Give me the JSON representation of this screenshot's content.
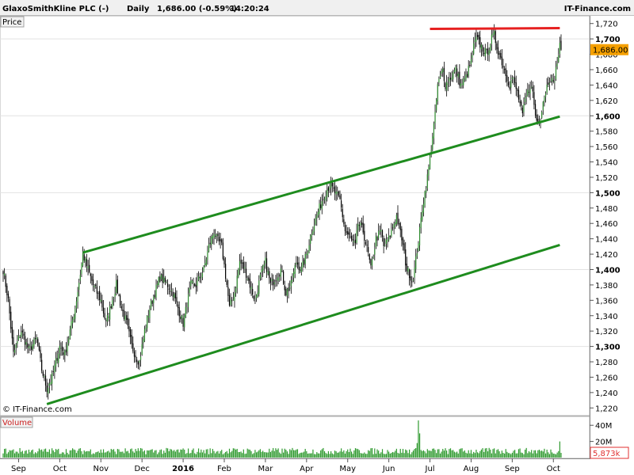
{
  "header": {
    "instrument": "GlaxoSmithKline PLC (-)",
    "interval": "Daily",
    "last": "1,686.00 (-0.59%)",
    "time": "14:20:24",
    "brand": "IT-Finance.com"
  },
  "price_panel": {
    "label": "Price",
    "watermark": "© IT-Finance.com",
    "last_badge": "1,686.00"
  },
  "volume_panel": {
    "label": "Volume",
    "last_badge": "5,873k"
  },
  "colors": {
    "up": "#2e8b2e",
    "down": "#000000",
    "wick": "#000000",
    "channel": "#1e8c1e",
    "resistance": "#e62020",
    "volume": "#2f9a2f",
    "badge_price": "#f5a000",
    "badge_volume_text": "#e03030"
  },
  "chart_data": {
    "type": "candlestick",
    "price_axis": {
      "ylim": [
        1210,
        1730
      ],
      "ticks": [
        {
          "v": 1220,
          "l": "1,220",
          "b": false
        },
        {
          "v": 1240,
          "l": "1,240",
          "b": false
        },
        {
          "v": 1260,
          "l": "1,260",
          "b": false
        },
        {
          "v": 1280,
          "l": "1,280",
          "b": false
        },
        {
          "v": 1300,
          "l": "1,300",
          "b": true
        },
        {
          "v": 1320,
          "l": "1,320",
          "b": false
        },
        {
          "v": 1340,
          "l": "1,340",
          "b": false
        },
        {
          "v": 1360,
          "l": "1,360",
          "b": false
        },
        {
          "v": 1380,
          "l": "1,380",
          "b": false
        },
        {
          "v": 1400,
          "l": "1,400",
          "b": true
        },
        {
          "v": 1420,
          "l": "1,420",
          "b": false
        },
        {
          "v": 1440,
          "l": "1,440",
          "b": false
        },
        {
          "v": 1460,
          "l": "1,460",
          "b": false
        },
        {
          "v": 1480,
          "l": "1,480",
          "b": false
        },
        {
          "v": 1500,
          "l": "1,500",
          "b": true
        },
        {
          "v": 1520,
          "l": "1,520",
          "b": false
        },
        {
          "v": 1540,
          "l": "1,540",
          "b": false
        },
        {
          "v": 1560,
          "l": "1,560",
          "b": false
        },
        {
          "v": 1580,
          "l": "1,580",
          "b": false
        },
        {
          "v": 1600,
          "l": "1,600",
          "b": true
        },
        {
          "v": 1620,
          "l": "1,620",
          "b": false
        },
        {
          "v": 1640,
          "l": "1,640",
          "b": false
        },
        {
          "v": 1660,
          "l": "1,660",
          "b": false
        },
        {
          "v": 1680,
          "l": "1,680",
          "b": false
        },
        {
          "v": 1700,
          "l": "1,700",
          "b": true
        },
        {
          "v": 1720,
          "l": "1,720",
          "b": false
        }
      ]
    },
    "volume_axis": {
      "ylim": [
        0,
        50
      ],
      "ticks": [
        {
          "v": 40,
          "l": "40M"
        },
        {
          "v": 20,
          "l": "20M"
        }
      ]
    },
    "x_axis": {
      "labels": [
        {
          "i": 12,
          "l": "Sep",
          "b": false
        },
        {
          "i": 44,
          "l": "Oct",
          "b": false
        },
        {
          "i": 76,
          "l": "Nov",
          "b": false
        },
        {
          "i": 108,
          "l": "Dec",
          "b": false
        },
        {
          "i": 140,
          "l": "2016",
          "b": true
        },
        {
          "i": 172,
          "l": "Feb",
          "b": false
        },
        {
          "i": 204,
          "l": "Mar",
          "b": false
        },
        {
          "i": 236,
          "l": "Apr",
          "b": false
        },
        {
          "i": 268,
          "l": "May",
          "b": false
        },
        {
          "i": 300,
          "l": "Jun",
          "b": false
        },
        {
          "i": 332,
          "l": "Jul",
          "b": false
        },
        {
          "i": 364,
          "l": "Aug",
          "b": false
        },
        {
          "i": 396,
          "l": "Sep",
          "b": false
        },
        {
          "i": 428,
          "l": "Oct",
          "b": false
        }
      ]
    },
    "anchors": [
      [
        0,
        1400
      ],
      [
        4,
        1360
      ],
      [
        8,
        1290
      ],
      [
        14,
        1320
      ],
      [
        20,
        1295
      ],
      [
        26,
        1310
      ],
      [
        30,
        1270
      ],
      [
        34,
        1245
      ],
      [
        38,
        1260
      ],
      [
        44,
        1300
      ],
      [
        48,
        1290
      ],
      [
        52,
        1320
      ],
      [
        56,
        1350
      ],
      [
        60,
        1395
      ],
      [
        62,
        1420
      ],
      [
        66,
        1400
      ],
      [
        70,
        1380
      ],
      [
        76,
        1360
      ],
      [
        80,
        1330
      ],
      [
        84,
        1355
      ],
      [
        88,
        1380
      ],
      [
        92,
        1350
      ],
      [
        96,
        1330
      ],
      [
        100,
        1300
      ],
      [
        104,
        1285
      ],
      [
        106,
        1280
      ],
      [
        110,
        1320
      ],
      [
        114,
        1350
      ],
      [
        118,
        1370
      ],
      [
        122,
        1390
      ],
      [
        128,
        1380
      ],
      [
        132,
        1370
      ],
      [
        136,
        1350
      ],
      [
        140,
        1330
      ],
      [
        146,
        1380
      ],
      [
        150,
        1380
      ],
      [
        156,
        1400
      ],
      [
        160,
        1430
      ],
      [
        164,
        1450
      ],
      [
        166,
        1440
      ],
      [
        170,
        1430
      ],
      [
        174,
        1380
      ],
      [
        176,
        1350
      ],
      [
        180,
        1370
      ],
      [
        184,
        1410
      ],
      [
        188,
        1400
      ],
      [
        192,
        1380
      ],
      [
        196,
        1360
      ],
      [
        200,
        1390
      ],
      [
        204,
        1410
      ],
      [
        208,
        1380
      ],
      [
        212,
        1390
      ],
      [
        216,
        1400
      ],
      [
        220,
        1370
      ],
      [
        224,
        1380
      ],
      [
        228,
        1410
      ],
      [
        232,
        1400
      ],
      [
        236,
        1420
      ],
      [
        240,
        1450
      ],
      [
        244,
        1470
      ],
      [
        248,
        1490
      ],
      [
        252,
        1505
      ],
      [
        254,
        1510
      ],
      [
        258,
        1500
      ],
      [
        262,
        1490
      ],
      [
        264,
        1470
      ],
      [
        266,
        1450
      ],
      [
        270,
        1440
      ],
      [
        274,
        1430
      ],
      [
        276,
        1460
      ],
      [
        280,
        1450
      ],
      [
        284,
        1420
      ],
      [
        286,
        1400
      ],
      [
        290,
        1440
      ],
      [
        294,
        1450
      ],
      [
        296,
        1430
      ],
      [
        300,
        1440
      ],
      [
        304,
        1460
      ],
      [
        306,
        1470
      ],
      [
        310,
        1440
      ],
      [
        314,
        1400
      ],
      [
        316,
        1395
      ],
      [
        318,
        1385
      ],
      [
        320,
        1400
      ],
      [
        324,
        1450
      ],
      [
        326,
        1480
      ],
      [
        328,
        1500
      ],
      [
        330,
        1520
      ],
      [
        332,
        1545
      ],
      [
        334,
        1575
      ],
      [
        336,
        1600
      ],
      [
        338,
        1640
      ],
      [
        340,
        1650
      ],
      [
        342,
        1660
      ],
      [
        344,
        1640
      ],
      [
        348,
        1650
      ],
      [
        352,
        1660
      ],
      [
        356,
        1640
      ],
      [
        360,
        1650
      ],
      [
        364,
        1670
      ],
      [
        366,
        1690
      ],
      [
        368,
        1700
      ],
      [
        372,
        1690
      ],
      [
        376,
        1680
      ],
      [
        380,
        1700
      ],
      [
        382,
        1705
      ],
      [
        384,
        1690
      ],
      [
        386,
        1680
      ],
      [
        388,
        1670
      ],
      [
        390,
        1660
      ],
      [
        392,
        1650
      ],
      [
        394,
        1640
      ],
      [
        396,
        1650
      ],
      [
        400,
        1630
      ],
      [
        402,
        1615
      ],
      [
        404,
        1600
      ],
      [
        406,
        1620
      ],
      [
        410,
        1640
      ],
      [
        412,
        1630
      ],
      [
        414,
        1600
      ],
      [
        416,
        1590
      ],
      [
        418,
        1600
      ],
      [
        420,
        1620
      ],
      [
        424,
        1645
      ],
      [
        426,
        1650
      ],
      [
        428,
        1640
      ],
      [
        430,
        1660
      ],
      [
        432,
        1680
      ],
      [
        433,
        1690
      ],
      [
        434,
        1686
      ]
    ],
    "channel_upper": {
      "p1": [
        62,
        1422
      ],
      "p2": [
        433,
        1599
      ]
    },
    "channel_lower": {
      "p1": [
        34,
        1225
      ],
      "p2": [
        433,
        1432
      ]
    },
    "resistance": {
      "p1": [
        332,
        1713
      ],
      "p2": [
        433,
        1714
      ]
    },
    "last_price": 1686,
    "last_volume_k": 5873
  }
}
